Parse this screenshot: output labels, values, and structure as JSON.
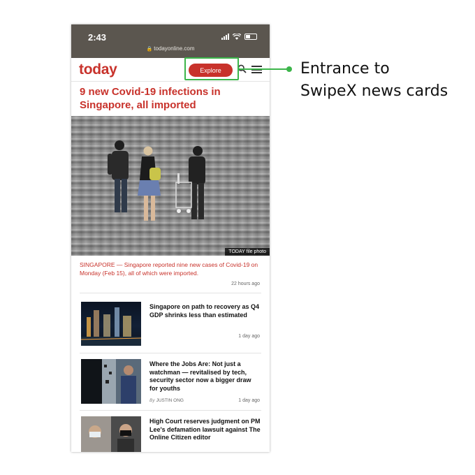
{
  "status_bar": {
    "time": "2:43",
    "url": "todayonline.com"
  },
  "header": {
    "logo": "today",
    "explore_label": "Explore"
  },
  "top_story": {
    "headline": "9 new Covid-19 infections in Singapore, all imported",
    "photo_credit": "TODAY file photo",
    "lead": "SINGAPORE — Singapore reported nine new cases of Covid-19 on Monday (Feb 15), all of which were imported.",
    "time": "22 hours ago"
  },
  "articles": [
    {
      "title": "Singapore on path to recovery as Q4 GDP shrinks less than estimated",
      "by_label": "",
      "author": "",
      "time": "1 day ago"
    },
    {
      "title": "Where the Jobs Are: Not just a watchman — revitalised by tech, security sector now a bigger draw for youths",
      "by_label": "By",
      "author": "JUSTIN ONG",
      "time": "1 day ago"
    },
    {
      "title": "High Court reserves judgment on PM Lee's defamation lawsuit against The Online Citizen editor",
      "by_label": "",
      "author": "",
      "time": ""
    }
  ],
  "annotation": {
    "line1": "Entrance to",
    "line2": "SwipeX news cards"
  },
  "colors": {
    "brand_red": "#c8322b",
    "callout_green": "#3cb54a",
    "status_bar": "#5b564f"
  },
  "icons": [
    "lock-icon",
    "search-icon",
    "menu-icon",
    "signal-icon",
    "wifi-icon",
    "battery-icon"
  ]
}
